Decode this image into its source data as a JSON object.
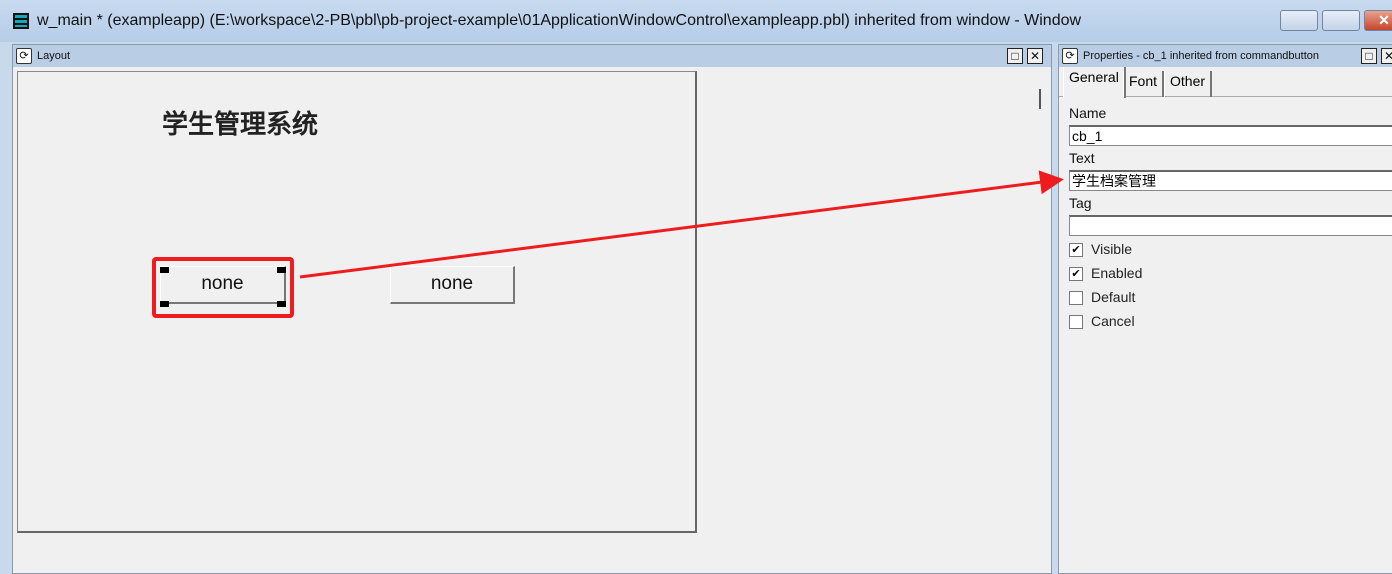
{
  "window": {
    "title": "w_main * (exampleapp) (E:\\workspace\\2-PB\\pbl\\pb-project-example\\01ApplicationWindowControl\\exampleapp.pbl) inherited from window - Window"
  },
  "layout": {
    "title": "Layout",
    "heading": "学生管理系统",
    "buttons": [
      {
        "label": "none",
        "selected": true
      },
      {
        "label": "none",
        "selected": false
      }
    ]
  },
  "properties": {
    "title": "Properties - cb_1 inherited from commandbutton",
    "tabs": [
      "General",
      "Font",
      "Other"
    ],
    "active_tab": "General",
    "name_label": "Name",
    "name_value": "cb_1",
    "text_label": "Text",
    "text_value": "学生档案管理",
    "tag_label": "Tag",
    "tag_value": "",
    "checkboxes": [
      {
        "label": "Visible",
        "checked": true
      },
      {
        "label": "Enabled",
        "checked": true
      },
      {
        "label": "Default",
        "checked": false
      },
      {
        "label": "Cancel",
        "checked": false
      }
    ]
  },
  "annotation": {
    "color": "#ee1c1c"
  }
}
